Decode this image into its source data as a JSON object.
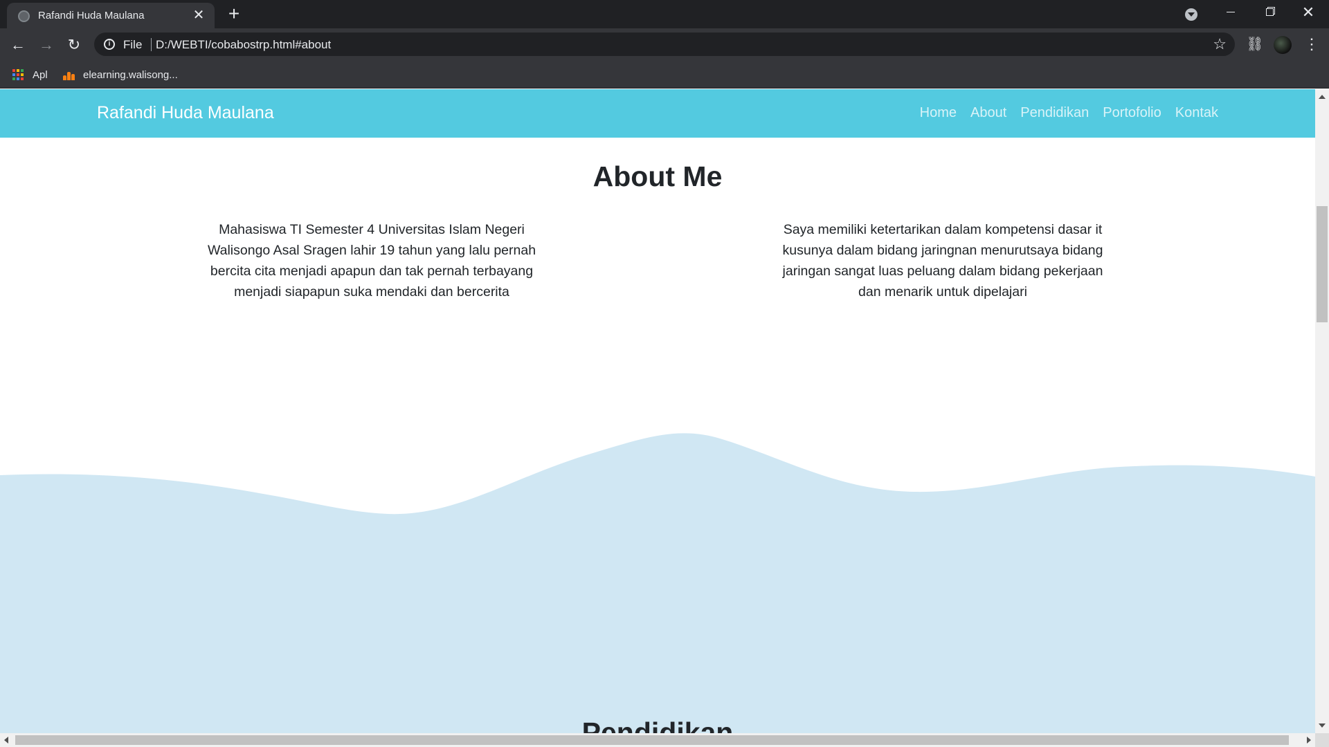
{
  "browser": {
    "tab_title": "Rafandi Huda Maulana",
    "tab_close": "✕",
    "new_tab": "+",
    "scheme_label": "File",
    "url": "D:/WEBTI/cobabostrp.html#about",
    "bookmarks": [
      {
        "label": "Apl",
        "icon": "apps-grid-icon"
      },
      {
        "label": "elearning.walisong...",
        "icon": "moodle-icon"
      }
    ],
    "window_controls": {
      "close": "✕"
    }
  },
  "site": {
    "brand": "Rafandi Huda Maulana",
    "nav": [
      "Home",
      "About",
      "Pendidikan",
      "Portofolio",
      "Kontak"
    ],
    "nav_color": "#53cae0",
    "wave_color": "#d0e7f3"
  },
  "about": {
    "title": "About Me",
    "left_text": "Mahasiswa TI Semester 4 Universitas Islam Negeri Walisongo Asal Sragen lahir 19 tahun yang lalu pernah bercita cita menjadi apapun dan tak pernah terbayang menjadi siapapun suka mendaki dan bercerita",
    "right_text": "Saya memiliki ketertarikan dalam kompetensi dasar it kusunya dalam bidang jaringnan menurutsaya bidang jaringan sangat luas peluang dalam bidang pekerjaan dan menarik untuk dipelajari"
  },
  "next_section": {
    "title": "Pendidikan"
  }
}
